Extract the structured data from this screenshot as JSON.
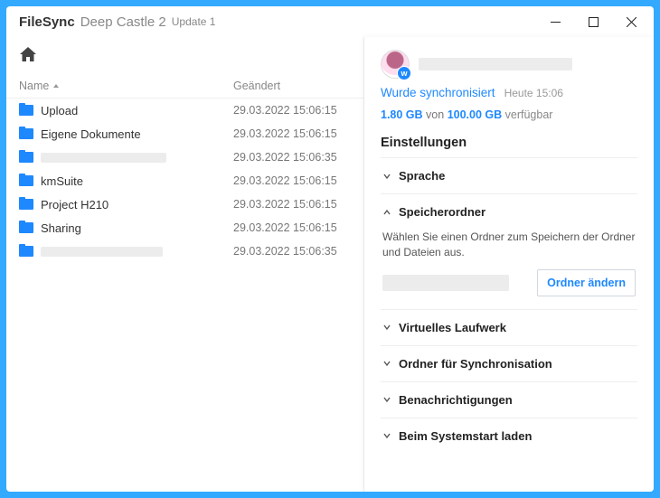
{
  "title": {
    "app": "FileSync",
    "edition": "Deep Castle 2",
    "update": "Update 1"
  },
  "columns": {
    "name": "Name",
    "modified": "Geändert"
  },
  "rows": [
    {
      "name": "Upload",
      "date": "29.03.2022 15:06:15",
      "redacted": false
    },
    {
      "name": "Eigene Dokumente",
      "date": "29.03.2022 15:06:15",
      "redacted": false
    },
    {
      "name": "",
      "date": "29.03.2022 15:06:35",
      "redacted": true
    },
    {
      "name": "kmSuite",
      "date": "29.03.2022 15:06:15",
      "redacted": false
    },
    {
      "name": "Project H210",
      "date": "29.03.2022 15:06:15",
      "redacted": false
    },
    {
      "name": "Sharing",
      "date": "29.03.2022 15:06:15",
      "redacted": false
    },
    {
      "name": "",
      "date": "29.03.2022 15:06:35",
      "redacted": true
    }
  ],
  "sync": {
    "status": "Wurde synchronisiert",
    "time": "Heute 15:06"
  },
  "storage": {
    "used": "1.80 GB",
    "of": "von",
    "total": "100.00 GB",
    "avail": "verfügbar"
  },
  "settings": {
    "heading": "Einstellungen",
    "language": "Sprache",
    "storageFolder": {
      "title": "Speicherordner",
      "desc": "Wählen Sie einen Ordner zum Speichern der Ordner und Dateien aus.",
      "changeBtn": "Ordner ändern"
    },
    "virtualDrive": "Virtuelles Laufwerk",
    "syncFolder": "Ordner für Synchronisation",
    "notifications": "Benachrichtigungen",
    "autostart": "Beim Systemstart laden"
  }
}
